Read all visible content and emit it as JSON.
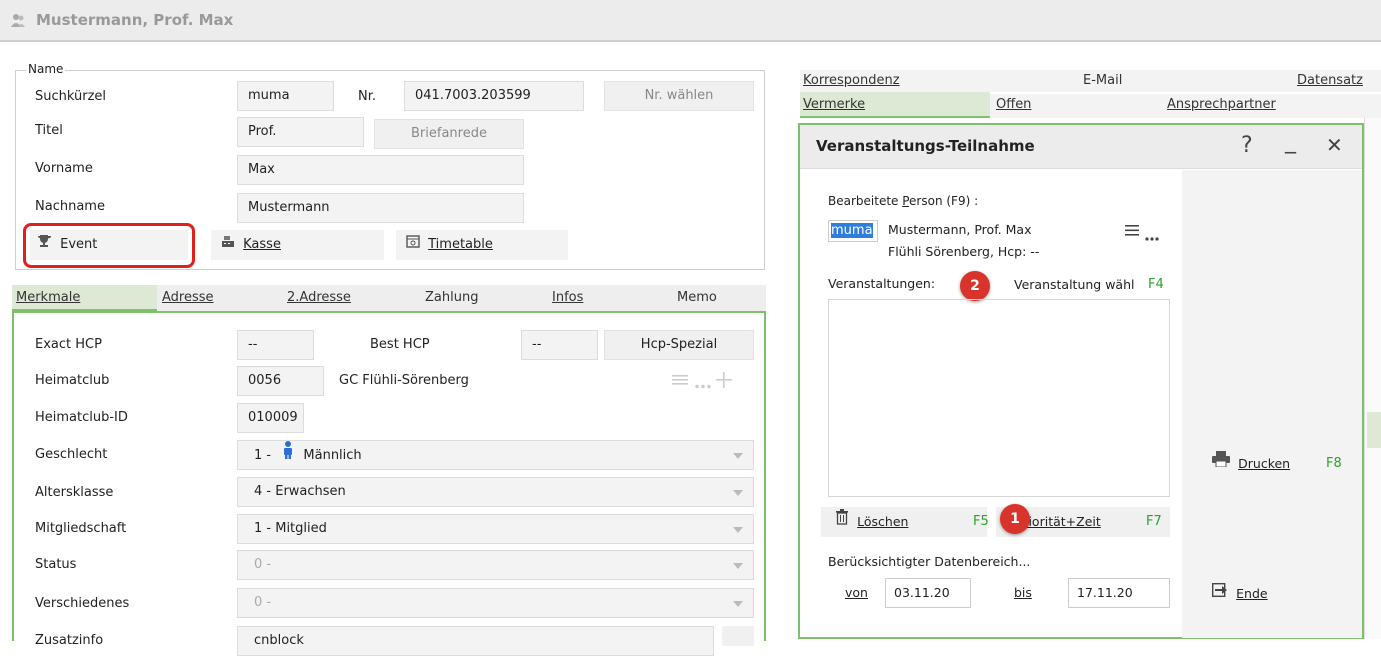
{
  "header": {
    "title": "Mustermann, Prof. Max"
  },
  "name_group": {
    "legend": "Name",
    "suchkuerzel_label": "Suchkürzel",
    "suchkuerzel_value": "muma",
    "nr_label": "Nr.",
    "nr_value": "041.7003.203599",
    "nr_button": "Nr. wählen",
    "titel_label": "Titel",
    "titel_value": "Prof.",
    "briefanrede_button": "Briefanrede",
    "vorname_label": "Vorname",
    "vorname_value": "Max",
    "nachname_label": "Nachname",
    "nachname_value": "Mustermann",
    "event_button": "Event",
    "kasse_button": "Kasse",
    "timetable_button": "Timetable"
  },
  "left_tabs": [
    "Merkmale",
    "Adresse",
    "2.Adresse",
    "Zahlung",
    "Infos",
    "Memo"
  ],
  "merkmale": {
    "exact_hcp_label": "Exact HCP",
    "exact_hcp_value": "--",
    "best_hcp_label": "Best HCP",
    "best_hcp_value": "--",
    "hcp_spezial_button": "Hcp-Spezial",
    "heimatclub_label": "Heimatclub",
    "heimatclub_code": "0056",
    "heimatclub_name": "GC Flühli-Sörenberg",
    "heimatclub_id_label": "Heimatclub-ID",
    "heimatclub_id_value": "010009",
    "geschlecht_label": "Geschlecht",
    "geschlecht_prefix": "1 -",
    "geschlecht_value": "Männlich",
    "altersklasse_label": "Altersklasse",
    "altersklasse_value": "4 - Erwachsen",
    "mitgliedschaft_label": "Mitgliedschaft",
    "mitgliedschaft_value": "1 - Mitglied",
    "status_label": "Status",
    "status_value": "0 -",
    "verschiedenes_label": "Verschiedenes",
    "verschiedenes_value": "0 -",
    "zusatz_label": "Zusatzinfo",
    "zusatz_value": "cnblock"
  },
  "right_tabs_row1": [
    "Korrespondenz",
    "E-Mail",
    "Datensatz"
  ],
  "right_tabs_row2": [
    "Vermerke",
    "Offen",
    "Ansprechpartner"
  ],
  "dialog": {
    "title": "Veranstaltungs-Teilnahme",
    "help": "?",
    "minimize": "_",
    "close": "✕",
    "person_label": "Bearbeitete Person (F9) :",
    "person_code": "muma",
    "person_name": "Mustermann, Prof. Max",
    "person_detail": "Flühli Sörenberg, Hcp: --",
    "veranstaltungen_label": "Veranstaltungen:",
    "waehlen_button": "Veranstaltung wähl",
    "waehlen_key": "F4",
    "loeschen_button": "Löschen",
    "loeschen_key": "F5",
    "prioritaet_button": "Priorität+Zeit",
    "prioritaet_key": "F7",
    "datenbereich_label": "Berücksichtigter Datenbereich...",
    "von_label": "von",
    "von_value": "03.11.20",
    "bis_label": "bis",
    "bis_value": "17.11.20",
    "drucken_button": "Drucken",
    "drucken_key": "F8",
    "ende_button": "Ende"
  },
  "badges": {
    "one": "1",
    "two": "2"
  },
  "colors": {
    "accent_green": "#7dc26a",
    "highlight_red": "#e0201c",
    "badge_red": "#d9342b"
  }
}
